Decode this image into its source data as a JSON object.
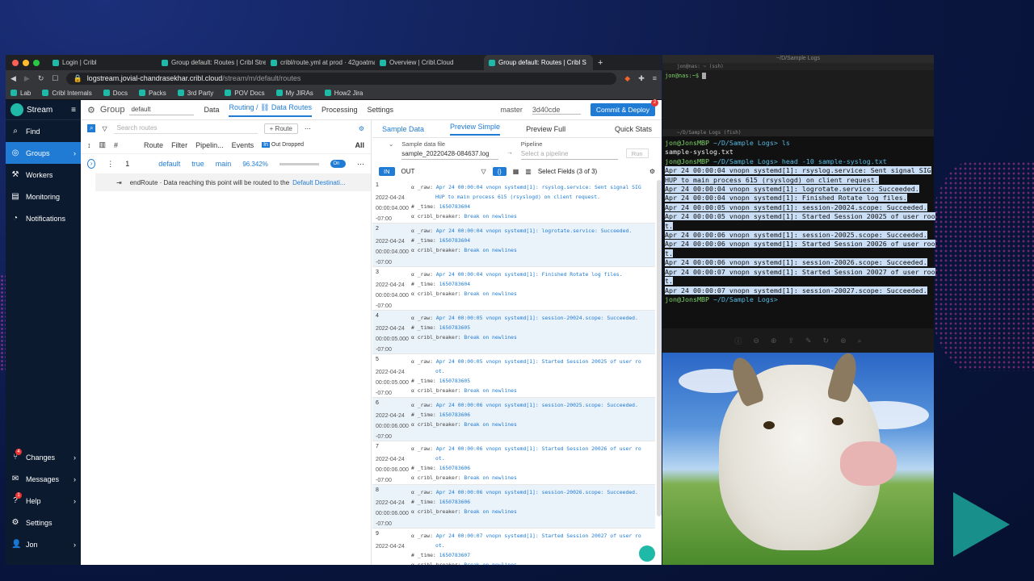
{
  "browser": {
    "tabs": [
      {
        "label": "Login | Cribl",
        "active": false
      },
      {
        "label": "Group default: Routes | Cribl Strea",
        "active": false
      },
      {
        "label": "cribl/route.yml at prod · 42goatma",
        "active": false
      },
      {
        "label": "Overview | Cribl.Cloud",
        "active": false
      },
      {
        "label": "Group default: Routes | Cribl S",
        "active": true
      }
    ],
    "url_host": "logstream.jovial-chandrasekhar.cribl.cloud",
    "url_path": "/stream/m/default/routes",
    "bookmarks": [
      "Lab",
      "Cribl Internals",
      "Docs",
      "Packs",
      "3rd Party",
      "POV Docs",
      "My JIRAs",
      "How2 Jira"
    ]
  },
  "sidebar": {
    "brand": "Stream",
    "items": [
      {
        "label": "Find",
        "icon": "search-icon"
      },
      {
        "label": "Groups",
        "icon": "groups-icon",
        "active": true
      },
      {
        "label": "Workers",
        "icon": "workers-icon"
      },
      {
        "label": "Monitoring",
        "icon": "monitoring-icon"
      },
      {
        "label": "Notifications",
        "icon": "bell-icon"
      }
    ],
    "bottom": [
      {
        "label": "Changes",
        "badge": "4"
      },
      {
        "label": "Messages",
        "badge": ""
      },
      {
        "label": "Help",
        "badge": "1"
      },
      {
        "label": "Settings",
        "badge": ""
      },
      {
        "label": "Jon",
        "badge": ""
      }
    ]
  },
  "topnav": {
    "group_label": "Group",
    "group_value": "default",
    "data": "Data",
    "routing": "Routing / ⛓ Data Routes",
    "processing": "Processing",
    "settings": "Settings",
    "branch": "master",
    "commit": "3d40cde",
    "deploy": "Commit & Deploy",
    "deploy_badge": "2"
  },
  "routes": {
    "search_placeholder": "Search routes",
    "add_route": "+ Route",
    "headers": {
      "num": "#",
      "route": "Route",
      "filter": "Filter",
      "pipeline": "Pipelin...",
      "events": "Events",
      "in": "In",
      "out": "Out",
      "dropped": "Dropped",
      "all": "All"
    },
    "row": {
      "num": "1",
      "route": "default",
      "filter": "true",
      "pipeline": "main",
      "pct": "96.342%",
      "toggle": "On"
    },
    "end_route": "endRoute · Data reaching this point will be routed to the",
    "end_link": "Default Destinati..."
  },
  "preview": {
    "tabs": [
      "Sample Data",
      "Preview Simple",
      "Preview Full",
      "Quick Stats"
    ],
    "sample_label": "Sample data file",
    "sample_value": "sample_20220428-084637.log",
    "pipeline_label": "Pipeline",
    "pipeline_placeholder": "Select a pipeline",
    "run": "Run",
    "in": "IN",
    "out": "OUT",
    "select_fields": "Select Fields (3 of 3)",
    "events": [
      {
        "num": "1",
        "date": "2022-04-24",
        "time": "00:00:04.000",
        "tz": "-07:00",
        "raw": "Apr 24 00:00:04 vnopn systemd[1]: rsyslog.service: Sent signal SIG",
        "raw2": "HUP to main process 615 (rsyslogd) on client request.",
        "t": "1650783604"
      },
      {
        "num": "2",
        "date": "2022-04-24",
        "time": "00:00:04.000",
        "tz": "-07:00",
        "raw": "Apr 24 00:00:04 vnopn systemd[1]: logrotate.service: Succeeded.",
        "raw2": "",
        "t": "1650783604"
      },
      {
        "num": "3",
        "date": "2022-04-24",
        "time": "00:00:04.000",
        "tz": "-07:00",
        "raw": "Apr 24 00:00:04 vnopn systemd[1]: Finished Rotate log files.",
        "raw2": "",
        "t": "1650783604"
      },
      {
        "num": "4",
        "date": "2022-04-24",
        "time": "00:00:05.000",
        "tz": "-07:00",
        "raw": "Apr 24 00:00:05 vnopn systemd[1]: session-20024.scope: Succeeded.",
        "raw2": "",
        "t": "1650783605"
      },
      {
        "num": "5",
        "date": "2022-04-24",
        "time": "00:00:05.000",
        "tz": "-07:00",
        "raw": "Apr 24 00:00:05 vnopn systemd[1]: Started Session 20025 of user ro",
        "raw2": "ot.",
        "t": "1650783605"
      },
      {
        "num": "6",
        "date": "2022-04-24",
        "time": "00:00:06.000",
        "tz": "-07:00",
        "raw": "Apr 24 00:00:06 vnopn systemd[1]: session-20025.scope: Succeeded.",
        "raw2": "",
        "t": "1650783606"
      },
      {
        "num": "7",
        "date": "2022-04-24",
        "time": "00:00:06.000",
        "tz": "-07:00",
        "raw": "Apr 24 00:00:06 vnopn systemd[1]: Started Session 20026 of user ro",
        "raw2": "ot.",
        "t": "1650783606"
      },
      {
        "num": "8",
        "date": "2022-04-24",
        "time": "00:00:06.000",
        "tz": "-07:00",
        "raw": "Apr 24 00:00:06 vnopn systemd[1]: session-20026.scope: Succeeded.",
        "raw2": "",
        "t": "1650783606"
      },
      {
        "num": "9",
        "date": "2022-04-24",
        "time": "",
        "tz": "",
        "raw": "Apr 24 00:00:07 vnopn systemd[1]: Started Session 20027 of user ro",
        "raw2": "ot.",
        "t": "1650783607"
      }
    ],
    "field_raw": "_raw:",
    "field_time": "_time:",
    "field_breaker": "cribl_breaker:",
    "breaker_value": "Break on newlines"
  },
  "terminal1": {
    "title": "~/D/Sample Logs",
    "sub": "jon@nas: ~ (ssh)",
    "prompt": "jon@nas:~$"
  },
  "terminal2": {
    "sub": "~/D/Sample Logs (fish)",
    "lines": [
      {
        "p": "jon@JonsMBP",
        "path": " ~/D/Sample Logs>",
        "cmd": " ls",
        "sel": false
      },
      {
        "text": "sample-syslog.txt",
        "sel": false
      },
      {
        "p": "jon@JonsMBP",
        "path": " ~/D/Sample Logs>",
        "cmd": " head -10 sample-syslog.txt",
        "sel": false
      },
      {
        "text": "Apr 24 00:00:04 vnopn systemd[1]: rsyslog.service: Sent signal SIG",
        "sel": true
      },
      {
        "text": "HUP to main process 615 (rsyslogd) on client request.",
        "sel": true
      },
      {
        "text": "Apr 24 00:00:04 vnopn systemd[1]: logrotate.service: Succeeded.",
        "sel": true
      },
      {
        "text": "Apr 24 00:00:04 vnopn systemd[1]: Finished Rotate log files.",
        "sel": true
      },
      {
        "text": "Apr 24 00:00:05 vnopn systemd[1]: session-20024.scope: Succeeded.",
        "sel": true
      },
      {
        "text": "Apr 24 00:00:05 vnopn systemd[1]: Started Session 20025 of user roo",
        "sel": true
      },
      {
        "text": "t.",
        "sel": true
      },
      {
        "text": "Apr 24 00:00:06 vnopn systemd[1]: session-20025.scope: Succeeded.",
        "sel": true
      },
      {
        "text": "Apr 24 00:00:06 vnopn systemd[1]: Started Session 20026 of user roo",
        "sel": true
      },
      {
        "text": "t.",
        "sel": true
      },
      {
        "text": "Apr 24 00:00:06 vnopn systemd[1]: session-20026.scope: Succeeded.",
        "sel": true
      },
      {
        "text": "Apr 24 00:00:07 vnopn systemd[1]: Started Session 20027 of user roo",
        "sel": true
      },
      {
        "text": "t.",
        "sel": true
      },
      {
        "text": "Apr 24 00:00:07 vnopn systemd[1]: session-20027.scope: Succeeded.",
        "sel": true
      },
      {
        "p": "jon@JonsMBP",
        "path": " ~/D/Sample Logs>",
        "cmd": "",
        "sel": false
      }
    ]
  }
}
